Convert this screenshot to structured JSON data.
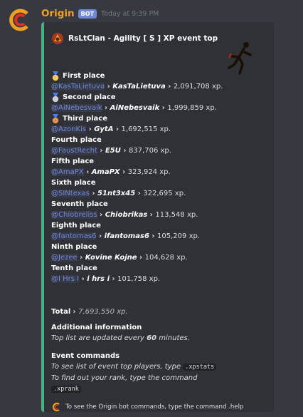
{
  "message": {
    "username": "Origin",
    "bot_tag": "BOT",
    "timestamp": "Today at 9:39 PM"
  },
  "embed": {
    "accent_color": "#43b581",
    "author_name": "RsLtClan - Agility [ S ] XP event top",
    "thumbnail_icon": "agility-runner-icon",
    "places": [
      {
        "title": "First place",
        "medal": "gold-medal-icon",
        "mention": "@KasTaLietuva",
        "name": "KasTaLietuva",
        "xp": "2,091,708 xp."
      },
      {
        "title": "Second place",
        "medal": "silver-medal-icon",
        "mention": "@AiNebesvaik",
        "name": "AiNebesvaik",
        "xp": "1,999,859 xp."
      },
      {
        "title": "Third place",
        "medal": "bronze-medal-icon",
        "mention": "@AzonKis",
        "name": "GytA",
        "xp": "1,692,515 xp."
      },
      {
        "title": "Fourth place",
        "mention": "@FaustRecht",
        "name": "E5U",
        "xp": "837,706 xp."
      },
      {
        "title": "Fifth place",
        "mention": "@AmaPX",
        "name": "AmaPX",
        "xp": "323,924 xp."
      },
      {
        "title": "Sixth place",
        "mention": "@SINtexas",
        "name": "51nt3x45",
        "xp": "322,695 xp."
      },
      {
        "title": "Seventh place",
        "mention": "@Chiobreliss",
        "name": "Chiobrikas",
        "xp": "113,548 xp."
      },
      {
        "title": "Eighth place",
        "mention": "@fantomas6",
        "name": "ifantomas6",
        "xp": "105,209 xp."
      },
      {
        "title": "Ninth place",
        "mention": "@Jezee",
        "name": "Kovine Kojne",
        "xp": "104,628 xp."
      },
      {
        "title": "Tenth place",
        "mention": "@I Hrs I",
        "name": "i hrs i",
        "xp": "101,758 xp."
      }
    ],
    "total_label": "Total",
    "total_value": "7,693,550 xp.",
    "additional": {
      "name": "Additional information",
      "text_before": "Top list are updated every ",
      "minutes": "60",
      "text_after": " minutes."
    },
    "commands": {
      "name": "Event commands",
      "line1": "To see list of event top players, type ",
      "code1": ".xpstats",
      "line2": "To find out your rank, type the command",
      "code2": ".xprank"
    },
    "footer": "To see the Origin bot commands, type the command .help"
  }
}
